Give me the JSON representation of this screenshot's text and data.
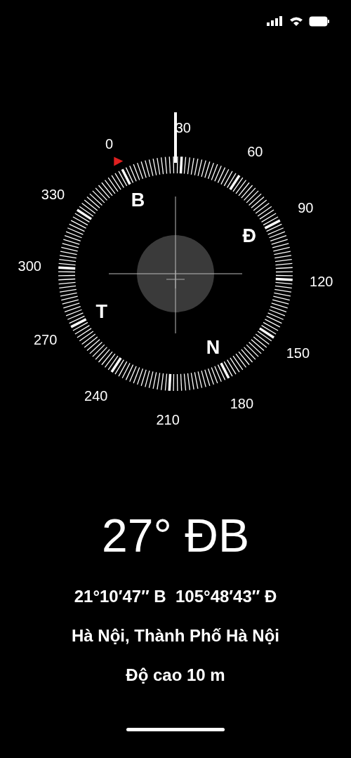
{
  "compass": {
    "degree_labels": [
      "0",
      "30",
      "60",
      "90",
      "120",
      "150",
      "180",
      "210",
      "240",
      "270",
      "300",
      "330"
    ],
    "cardinals": [
      "B",
      "Đ",
      "N",
      "T"
    ]
  },
  "heading": "27° ĐB",
  "coordinates": "21°10′47″ B  105°48′43″ Đ",
  "location": "Hà Nội, Thành Phố Hà Nội",
  "altitude": "Độ cao 10 m"
}
